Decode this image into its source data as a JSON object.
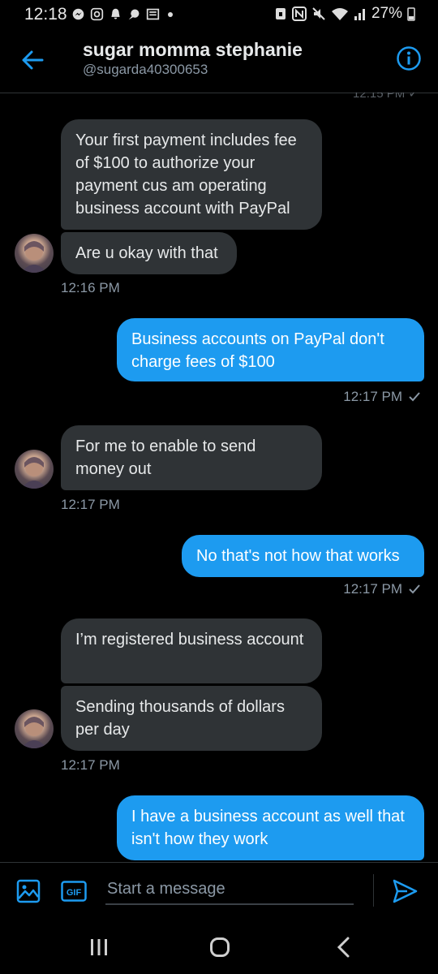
{
  "status_bar": {
    "time": "12:18",
    "battery": "27%"
  },
  "header": {
    "name": "sugar momma stephanie",
    "handle": "@sugarda40300653"
  },
  "previous_timestamp": "12:15 PM",
  "messages": [
    {
      "text": "Your first payment includes fee of $100 to authorize your payment cus am operating business account with PayPal"
    },
    {
      "text": "Are u okay with that"
    },
    {
      "time": "12:16 PM"
    },
    {
      "text": "Business accounts on PayPal don't charge fees of $100"
    },
    {
      "time": "12:17 PM"
    },
    {
      "text": "For me to enable to send money out"
    },
    {
      "time": "12:17 PM"
    },
    {
      "text": "No that's not how that works"
    },
    {
      "time": "12:17 PM"
    },
    {
      "text": "I’m registered business account"
    },
    {
      "text": "Sending thousands of dollars per day"
    },
    {
      "time": "12:17 PM"
    },
    {
      "text": "I have a business account as well that isn't how they work"
    }
  ],
  "composer": {
    "placeholder": "Start a message",
    "gif_label": "GIF"
  },
  "colors": {
    "accent": "#1d9bf0",
    "incoming_bubble": "#2f3336",
    "background": "#000000"
  },
  "icons": [
    "back-arrow-icon",
    "info-icon",
    "image-icon",
    "gif-icon",
    "send-icon",
    "recent-apps-icon",
    "home-icon",
    "nav-back-icon"
  ]
}
